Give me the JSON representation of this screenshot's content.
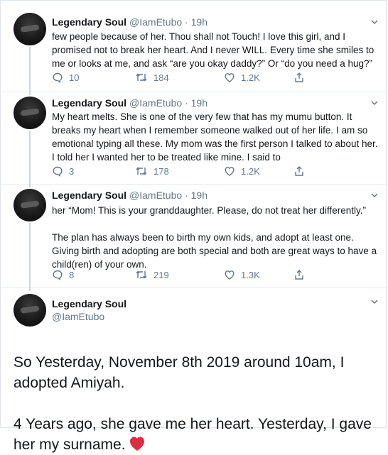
{
  "tweets": [
    {
      "name": "Legendary Soul",
      "handle": "@IamEtubo",
      "dot": "·",
      "time": "19h",
      "text": "few people because of her. Thou shall not Touch! I love this girl, and I promised not to break her heart. And I never WILL. Every time she smiles to me or looks at me, and ask “are you okay daddy?” Or “do you need a hug?”",
      "replies": "10",
      "retweets": "184",
      "likes": "1.2K"
    },
    {
      "name": "Legendary Soul",
      "handle": "@IamEtubo",
      "dot": "·",
      "time": "19h",
      "text": "My heart melts. She is one of the very few that has my mumu button. It breaks my heart when I remember someone walked out of her life. I am so emotional typing all these. My mom was the first person I talked to about her. I told her I wanted her to be treated like mine. I said to",
      "replies": "3",
      "retweets": "178",
      "likes": "1.2K"
    },
    {
      "name": "Legendary Soul",
      "handle": "@IamEtubo",
      "dot": "·",
      "time": "19h",
      "text": "her “Mom! This is your granddaughter. Please, do not treat her differently.”\n\nThe plan has always been to birth my own kids, and adopt at least one. Giving birth and adopting are both special and both are great ways to have a child(ren) of your own.",
      "replies": "8",
      "retweets": "219",
      "likes": "1.3K"
    }
  ],
  "main_tweet": {
    "name": "Legendary Soul",
    "handle": "@IamEtubo",
    "text": "So Yesterday, November 8th 2019 around 10am, I adopted Amiyah.\n\n4 Years ago, she gave me her heart. Yesterday, I gave her my surname.",
    "emoji": "red-heart-icon"
  },
  "colors": {
    "text": "#14171a",
    "secondary": "#657786",
    "thread_line": "#ccd6dd",
    "heart": "#e0245e"
  }
}
